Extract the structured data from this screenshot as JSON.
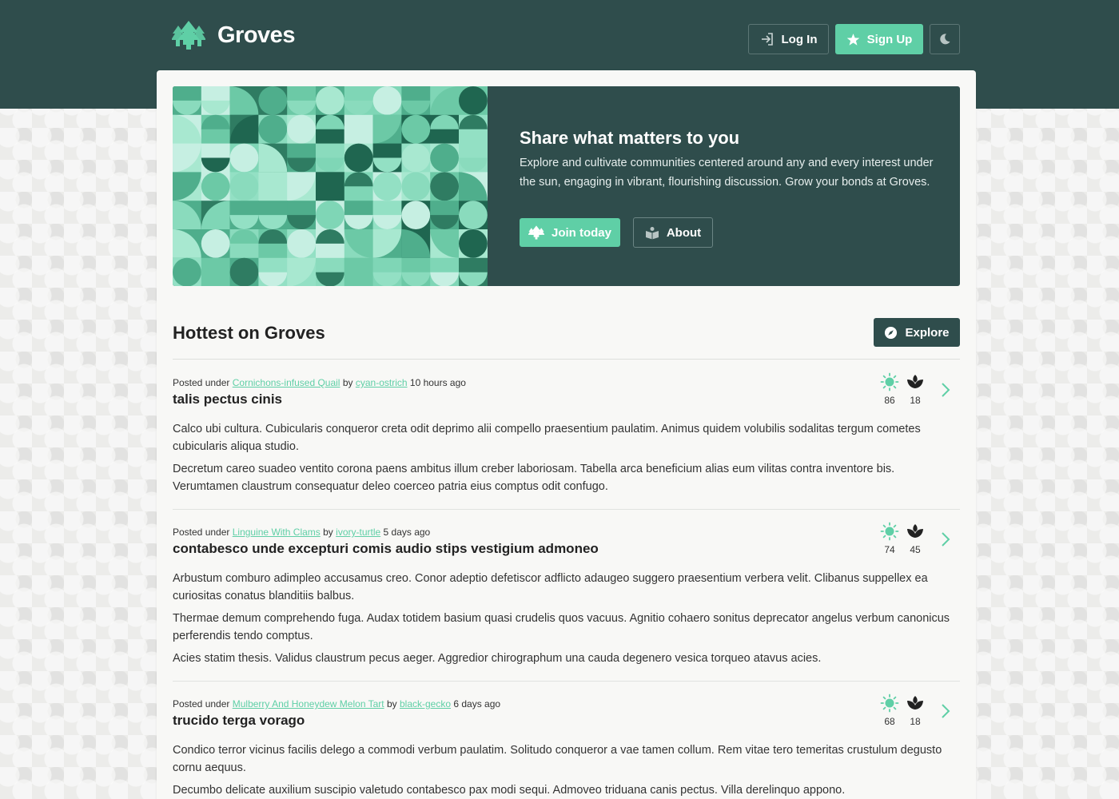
{
  "brand": {
    "name": "Groves"
  },
  "header": {
    "login_label": "Log In",
    "signup_label": "Sign Up"
  },
  "hero": {
    "title": "Share what matters to you",
    "description": "Explore and cultivate communities centered around any and every interest under the sun, engaging in vibrant, flourishing discussion. Grow your bonds at Groves.",
    "join_label": "Join today",
    "about_label": "About"
  },
  "section": {
    "title": "Hottest on Groves",
    "explore_label": "Explore"
  },
  "posts": [
    {
      "prefix": "Posted under",
      "community": "Cornichons-infused Quail",
      "by": "by",
      "author": "cyan-ostrich",
      "time": "10 hours ago",
      "title": "talis pectus cinis",
      "paragraphs": [
        "Calco ubi cultura. Cubicularis conqueror creta odit deprimo alii compello praesentium paulatim. Animus quidem volubilis sodalitas tergum cometes cubicularis aliqua studio.",
        "Decretum careo suadeo ventito corona paens ambitus illum creber laboriosam. Tabella arca beneficium alias eum vilitas contra inventore bis. Verumtamen claustrum consequatur deleo coerceo patria eius comptus odit confugo."
      ],
      "sun_count": "86",
      "sprout_count": "18"
    },
    {
      "prefix": "Posted under",
      "community": "Linguine With Clams",
      "by": "by",
      "author": "ivory-turtle",
      "time": "5 days ago",
      "title": "contabesco unde excepturi comis audio stips vestigium admoneo",
      "paragraphs": [
        "Arbustum comburo adimpleo accusamus creo. Conor adeptio defetiscor adflicto adaugeo suggero praesentium verbera velit. Clibanus suppellex ea curiositas conatus blanditiis balbus.",
        "Thermae demum comprehendo fuga. Audax totidem basium quasi crudelis quos vacuus. Agnitio cohaero sonitus deprecator angelus verbum canonicus perferendis tendo comptus.",
        "Acies statim thesis. Validus claustrum pecus aeger. Aggredior chirographum una cauda degenero vesica torqueo atavus acies."
      ],
      "sun_count": "74",
      "sprout_count": "45"
    },
    {
      "prefix": "Posted under",
      "community": "Mulberry And Honeydew Melon Tart",
      "by": "by",
      "author": "black-gecko",
      "time": "6 days ago",
      "title": "trucido terga vorago",
      "paragraphs": [
        "Condico terror vicinus facilis delego a commodi verbum paulatim. Solitudo conqueror a vae tamen collum. Rem vitae tero temeritas crustulum degusto cornu aequus.",
        "Decumbo delicate auxilium suscipio valetudo contabesco pax modi sequi. Admoveo triduana canis pectus. Villa derelinquo appono."
      ],
      "sun_count": "68",
      "sprout_count": "18"
    }
  ],
  "icons": {
    "logo": "trees-icon",
    "login": "login-icon",
    "signup": "star-icon",
    "theme": "moon-icon",
    "join": "trees-icon",
    "about": "book-icon",
    "explore": "compass-icon",
    "sun": "sun-icon",
    "sprout": "sprout-icon",
    "open": "chevron-right-icon"
  },
  "colors": {
    "primary_dark": "#2f4d4c",
    "accent": "#5fcfa6",
    "card_bg": "#f8f8f6"
  }
}
